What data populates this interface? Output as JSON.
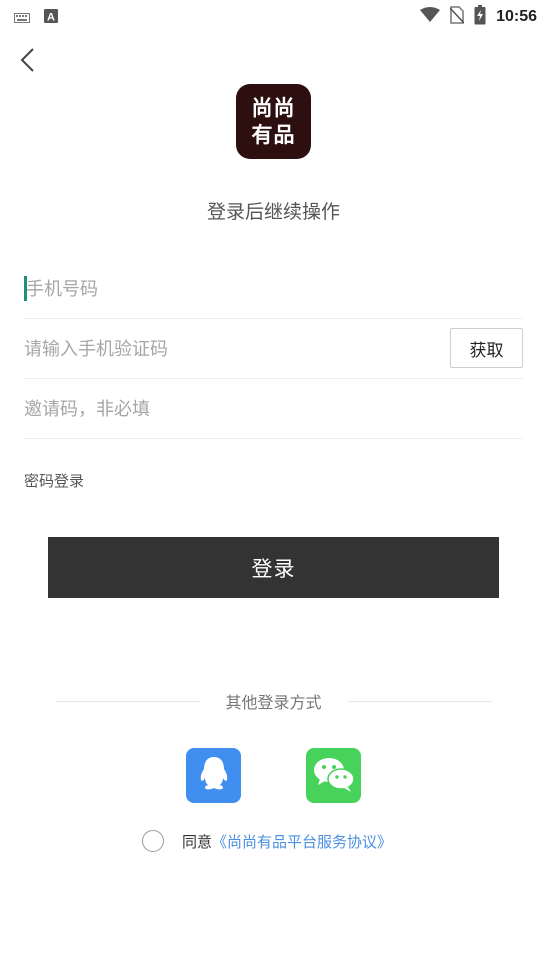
{
  "status_bar": {
    "time": "10:56",
    "left_icons": [
      "keyboard-icon",
      "text-a-icon"
    ],
    "right_icons": [
      "wifi-icon",
      "no-sim-icon",
      "battery-charging-icon"
    ]
  },
  "header": {
    "back_icon": "chevron-left-icon"
  },
  "logo": {
    "line1": "尚尚",
    "line2": "有品",
    "bg_color": "#2e0f0f"
  },
  "subtitle": "登录后继续操作",
  "form": {
    "phone_placeholder": "手机号码",
    "code_placeholder": "请输入手机验证码",
    "get_code_label": "获取",
    "invite_placeholder": "邀请码，非必填"
  },
  "password_login_label": "密码登录",
  "login_button_label": "登录",
  "other_login_label": "其他登录方式",
  "social": [
    {
      "name": "qq-icon",
      "color": "#3f8ef0"
    },
    {
      "name": "wechat-icon",
      "color": "#46d25b"
    }
  ],
  "agreement": {
    "prefix": "同意",
    "link": "《尚尚有品平台服务协议》",
    "link_color": "#4a90e2"
  },
  "colors": {
    "cursor": "#1e8f7c",
    "login_button_bg": "#333333"
  }
}
